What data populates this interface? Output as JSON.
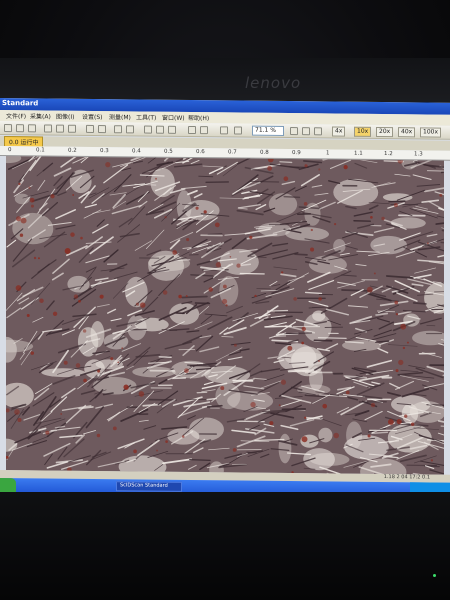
{
  "monitor": {
    "brand": "lenovo"
  },
  "window": {
    "title": "Standard",
    "menu": [
      "文件(F)",
      "采集(A)",
      "图像(I)",
      "设置(S)",
      "测量(M)",
      "工具(T)",
      "窗口(W)",
      "帮助(H)"
    ],
    "zoom_value": "71.1 %",
    "toolbar_buttons": [
      "4x",
      "10x",
      "20x",
      "40x",
      "100x"
    ],
    "active_button_index": 1,
    "active_tab": "0.0 运行中",
    "ruler_ticks": [
      "0",
      "0.1",
      "0.2",
      "0.3",
      "0.4",
      "0.5",
      "0.6",
      "0.7",
      "0.8",
      "0.9",
      "1",
      "1.1",
      "1.2",
      "1.3"
    ],
    "status_text": "1.18  2  04  17:2  0.1"
  },
  "taskbar": {
    "task_label": "ScIDScan Standard"
  },
  "image": {
    "subject": "microscope cell culture (spindle-shaped fibroblast-like cells)",
    "dominant_colors": [
      "#6e5a5e",
      "#e8e2dc",
      "#8a2c22"
    ]
  }
}
